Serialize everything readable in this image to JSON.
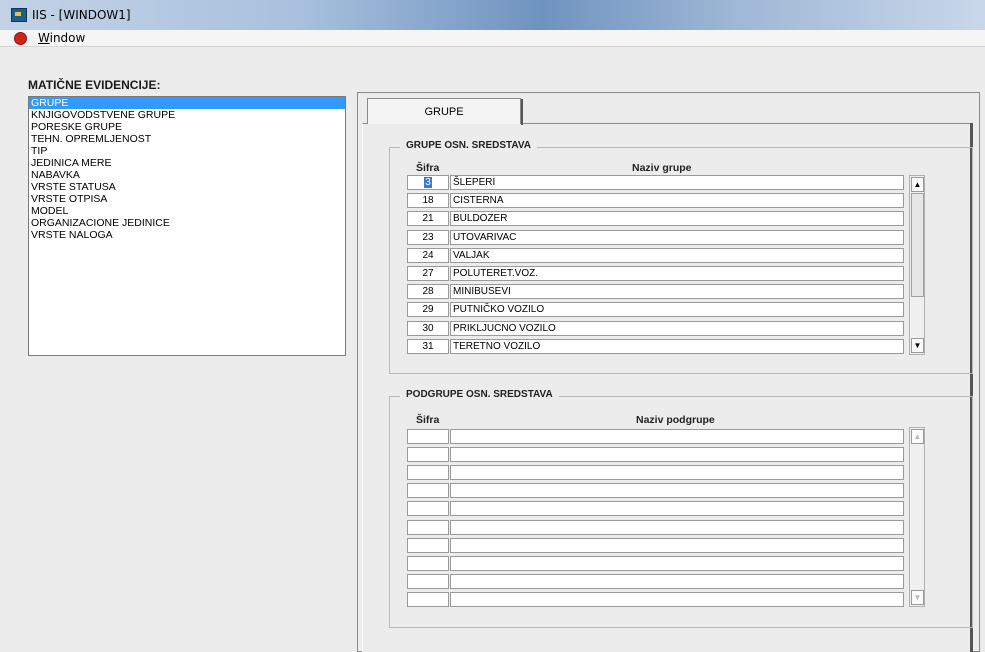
{
  "window": {
    "title": "IIS - [WINDOW1]"
  },
  "menu": {
    "window_label_first": "W",
    "window_label_rest": "indow"
  },
  "left": {
    "heading": "MATIČNE EVIDENCIJE:",
    "items": [
      "GRUPE",
      "KNJIGOVODSTVENE GRUPE",
      "PORESKE GRUPE",
      "TEHN. OPREMLJENOST",
      "TIP",
      "JEDINICA MERE",
      "NABAVKA",
      "VRSTE STATUSA",
      "VRSTE OTPISA",
      "MODEL",
      "ORGANIZACIONE JEDINICE",
      "VRSTE NALOGA"
    ],
    "selected_index": 0
  },
  "tab": {
    "label": "GRUPE"
  },
  "groups": {
    "legend": "GRUPE OSN. SREDSTAVA",
    "col_code": "Šifra",
    "col_name": "Naziv grupe",
    "rows": [
      {
        "code": "3",
        "name": "ŠLEPERI"
      },
      {
        "code": "18",
        "name": "CISTERNA"
      },
      {
        "code": "21",
        "name": "BULDOZER"
      },
      {
        "code": "23",
        "name": "UTOVARIVAC"
      },
      {
        "code": "24",
        "name": "VALJAK"
      },
      {
        "code": "27",
        "name": "POLUTERET.VOZ."
      },
      {
        "code": "28",
        "name": "MINIBUSEVI"
      },
      {
        "code": "29",
        "name": "PUTNIČKO VOZILO"
      },
      {
        "code": "30",
        "name": "PRIKLJUCNO VOZILO"
      },
      {
        "code": "31",
        "name": "TERETNO VOZILO"
      }
    ]
  },
  "subgroups": {
    "legend": "PODGRUPE OSN. SREDSTAVA",
    "col_code": "Šifra",
    "col_name": "Naziv podgrupe",
    "rows": [
      {
        "code": "",
        "name": ""
      },
      {
        "code": "",
        "name": ""
      },
      {
        "code": "",
        "name": ""
      },
      {
        "code": "",
        "name": ""
      },
      {
        "code": "",
        "name": ""
      },
      {
        "code": "",
        "name": ""
      },
      {
        "code": "",
        "name": ""
      },
      {
        "code": "",
        "name": ""
      },
      {
        "code": "",
        "name": ""
      },
      {
        "code": "",
        "name": ""
      }
    ]
  },
  "icons": {
    "scroll_up": "▲",
    "scroll_down": "▼"
  },
  "colors": {
    "selection": "#3399ff",
    "menu_icon": "#d0241a"
  }
}
